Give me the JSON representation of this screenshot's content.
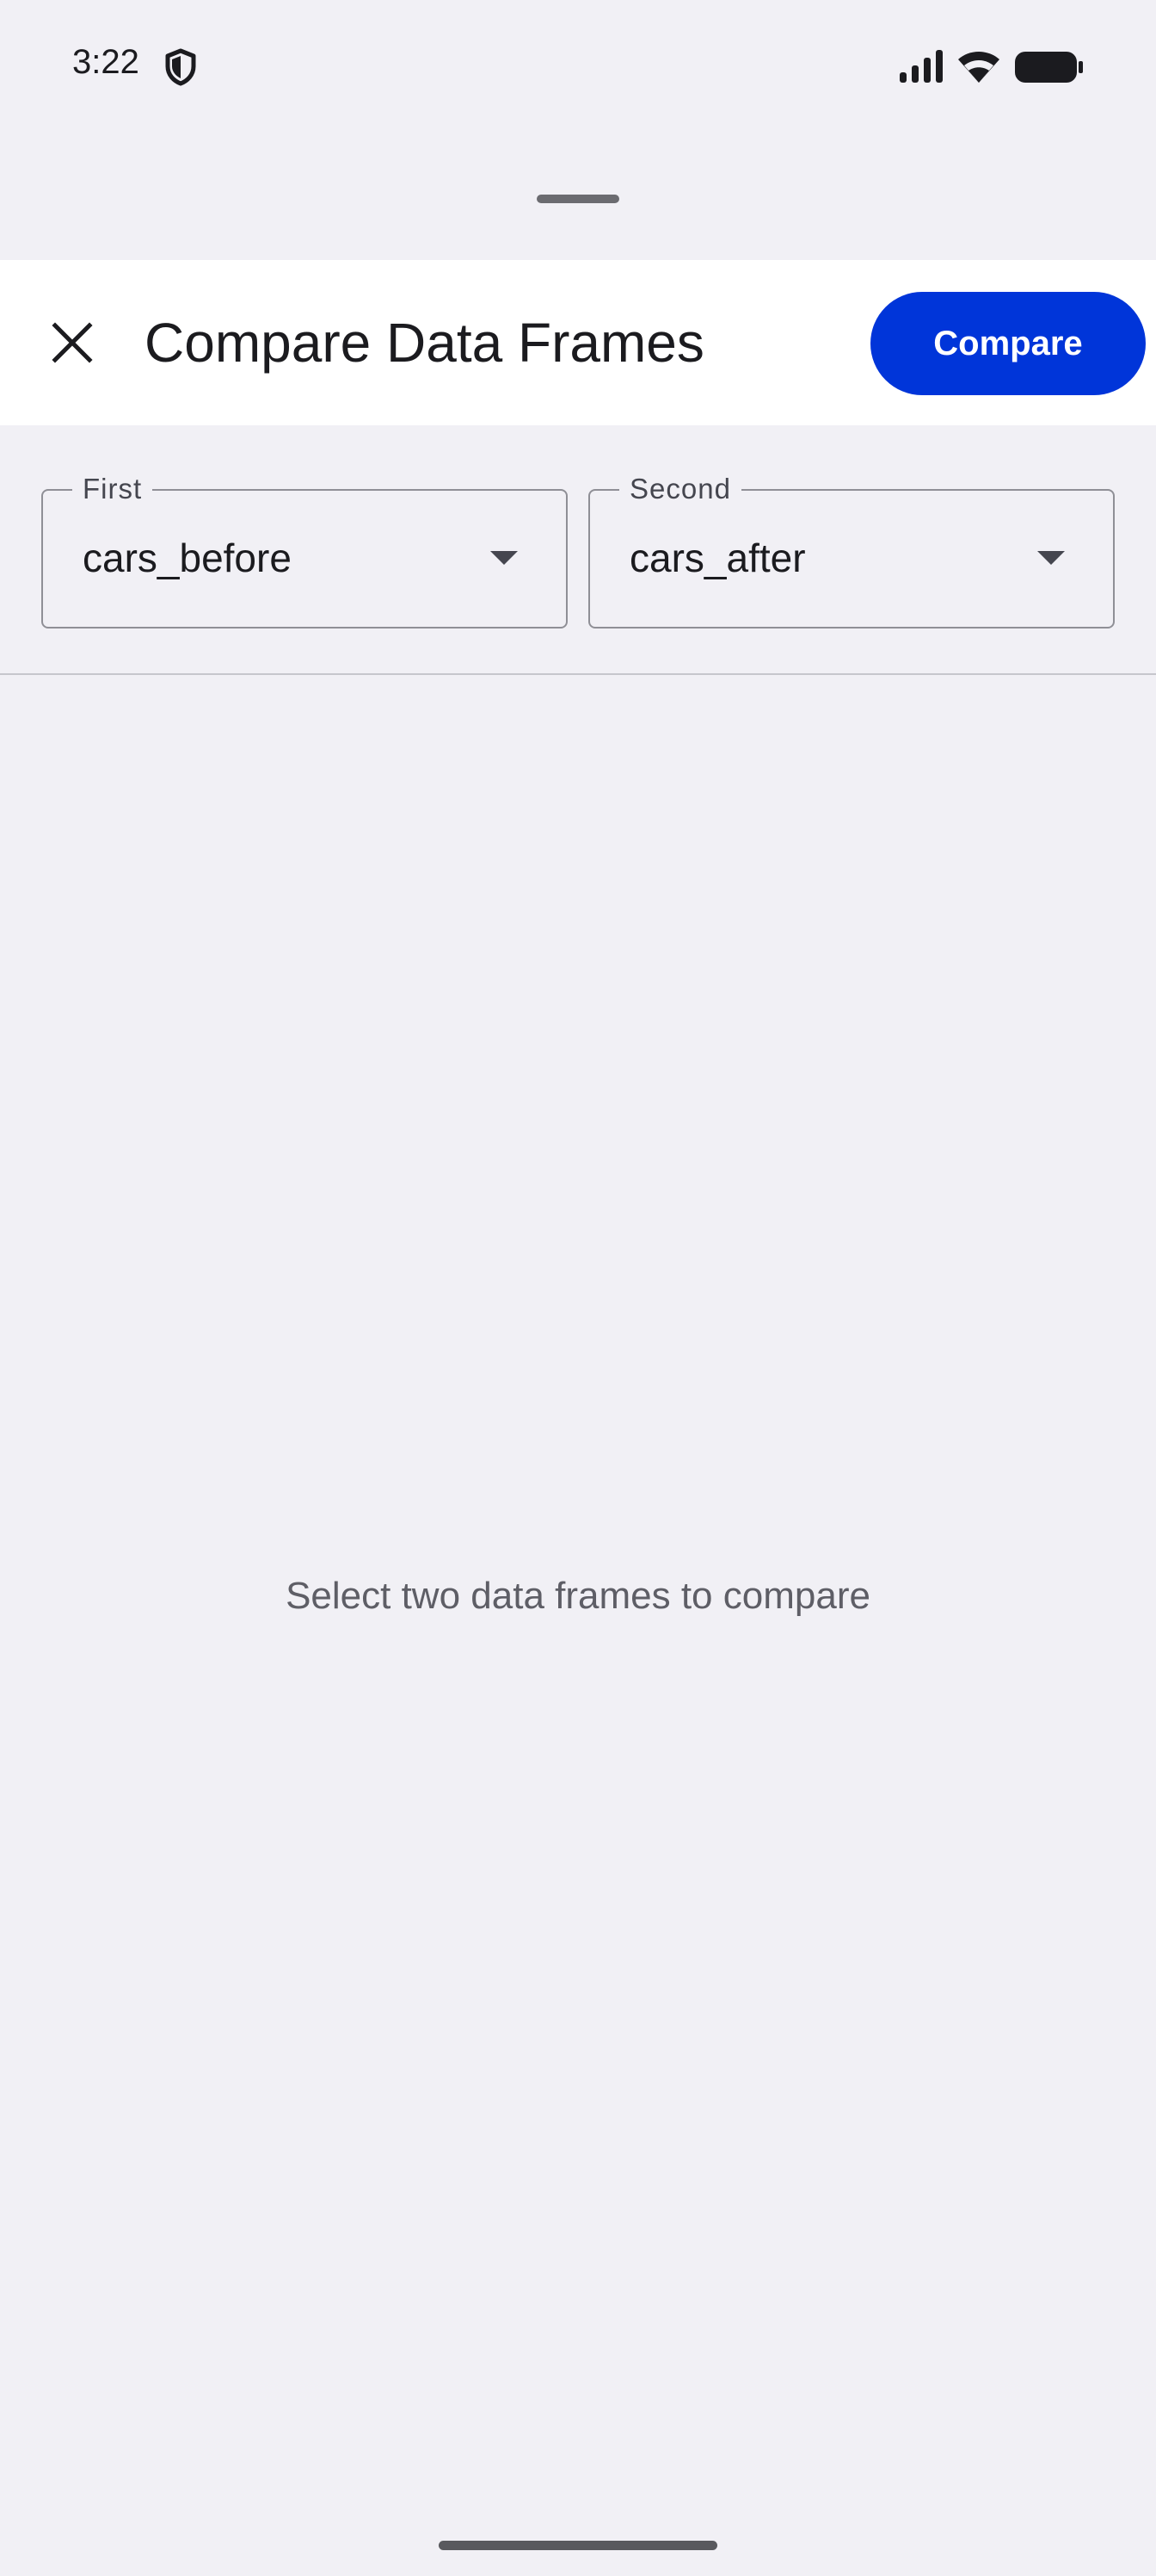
{
  "status_bar": {
    "time": "3:22",
    "icons": [
      "shield-icon",
      "signal-icon",
      "wifi-icon",
      "battery-icon"
    ]
  },
  "top_bar": {
    "close_icon": "close-icon",
    "title": "Compare Data Frames",
    "compare_label": "Compare"
  },
  "selectors": {
    "first": {
      "label": "First",
      "value": "cars_before"
    },
    "second": {
      "label": "Second",
      "value": "cars_after"
    }
  },
  "content": {
    "empty_message": "Select two data frames to compare"
  },
  "colors": {
    "accent": "#0035d9",
    "background": "#f1f0f5",
    "surface": "#ffffff"
  }
}
